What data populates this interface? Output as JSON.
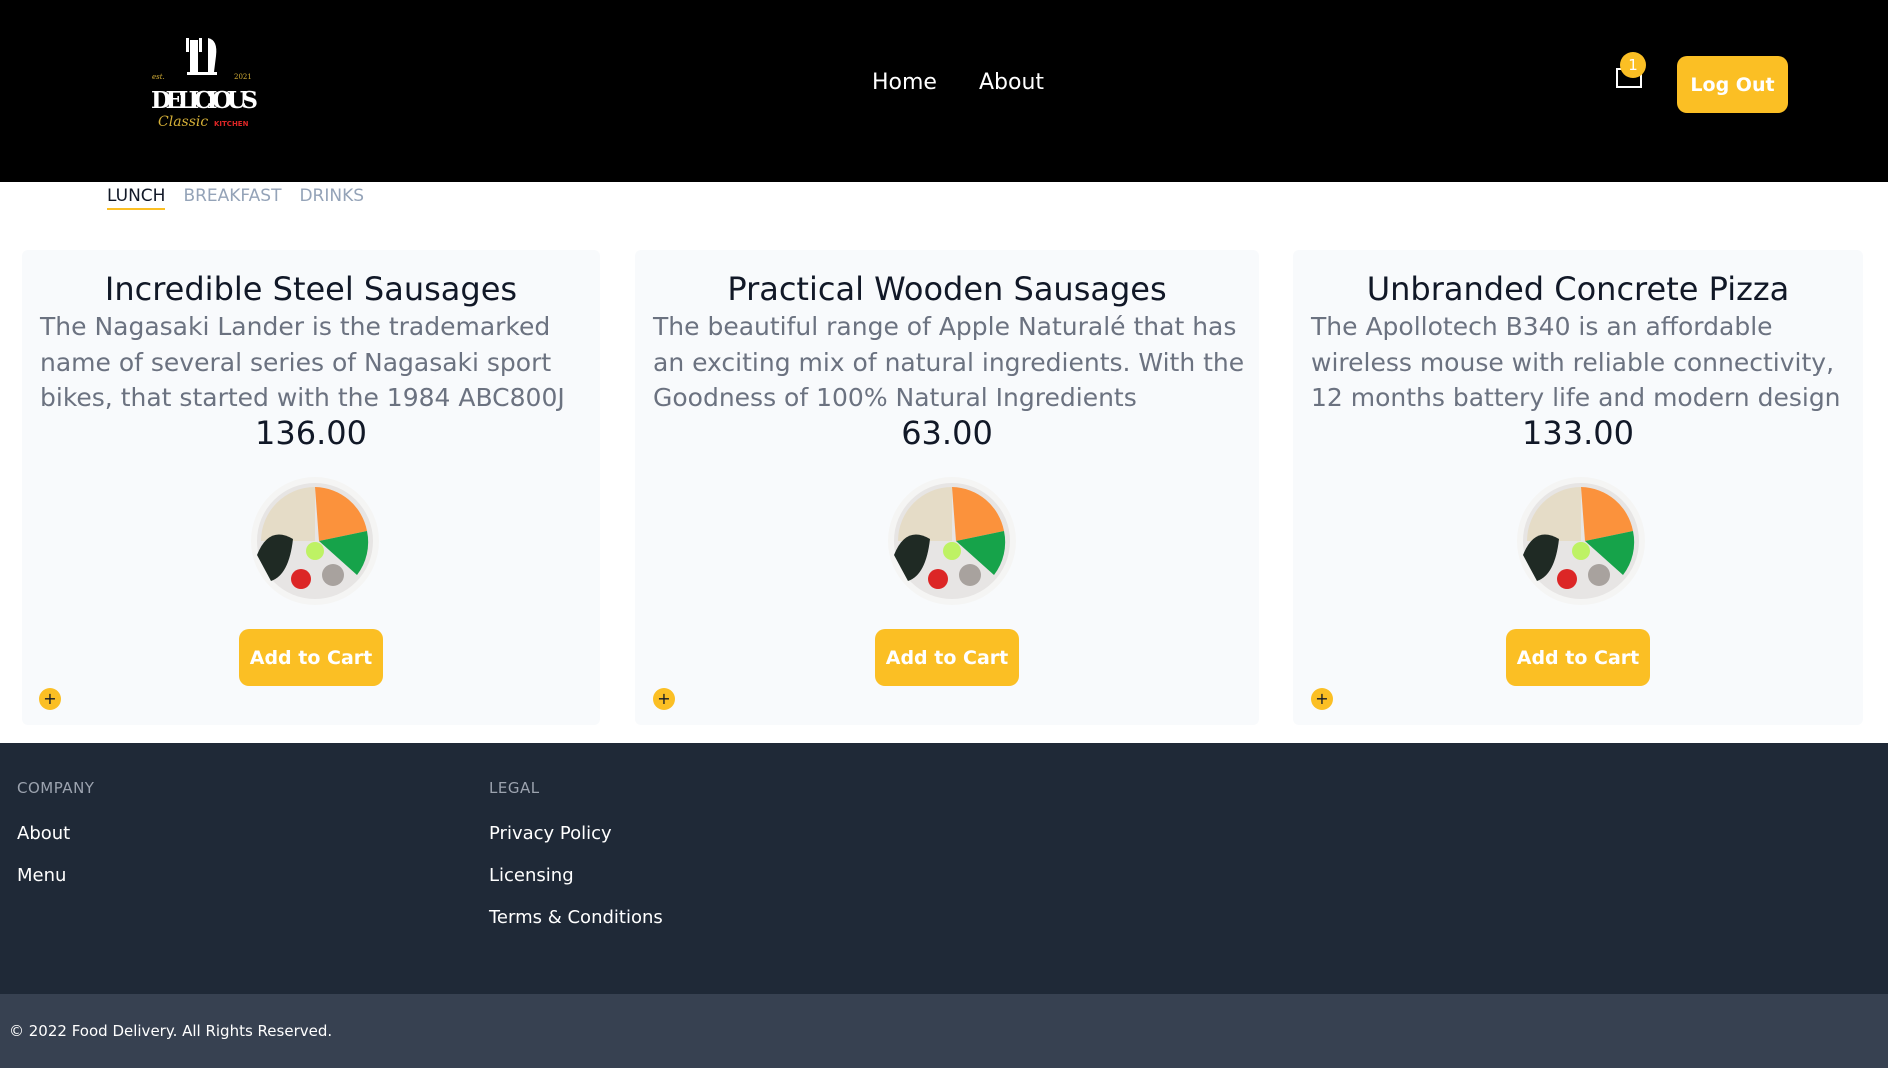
{
  "header": {
    "logo": {
      "text_top": "DELICIOUS",
      "text_script": "Classic",
      "text_sub": "KITCHEN",
      "est": "est.",
      "year": "2021"
    },
    "nav": [
      {
        "label": "Home"
      },
      {
        "label": "About"
      }
    ],
    "cart_count": "1",
    "logout_label": "Log Out"
  },
  "tabs": [
    {
      "label": "LUNCH",
      "active": true
    },
    {
      "label": "BREAKFAST",
      "active": false
    },
    {
      "label": "DRINKS",
      "active": false
    }
  ],
  "products": [
    {
      "title": "Incredible Steel Sausages",
      "description": "The Nagasaki Lander is the trademarked name of several series of Nagasaki sport bikes, that started with the 1984 ABC800J",
      "price": "136.00",
      "add_label": "Add to Cart",
      "plus_label": "+"
    },
    {
      "title": "Practical Wooden Sausages",
      "description": "The beautiful range of Apple Naturalé that has an exciting mix of natural ingredients. With the Goodness of 100% Natural Ingredients",
      "price": "63.00",
      "add_label": "Add to Cart",
      "plus_label": "+"
    },
    {
      "title": "Unbranded Concrete Pizza",
      "description": "The Apollotech B340 is an affordable wireless mouse with reliable connectivity, 12 months battery life and modern design",
      "price": "133.00",
      "add_label": "Add to Cart",
      "plus_label": "+"
    }
  ],
  "footer": {
    "company": {
      "heading": "COMPANY",
      "links": [
        "About",
        "Menu"
      ]
    },
    "legal": {
      "heading": "LEGAL",
      "links": [
        "Privacy Policy",
        "Licensing",
        "Terms & Conditions"
      ]
    },
    "copyright": "© 2022 Food Delivery. All Rights Reserved."
  },
  "colors": {
    "accent": "#fbbf24",
    "header_bg": "#000000",
    "footer_bg": "#1f2937",
    "bottom_bar_bg": "#374151",
    "card_bg": "#f8fafc"
  },
  "icons": {
    "cart": "shopping-bag-icon",
    "food": "food-bowl-image",
    "plus": "plus-icon"
  }
}
